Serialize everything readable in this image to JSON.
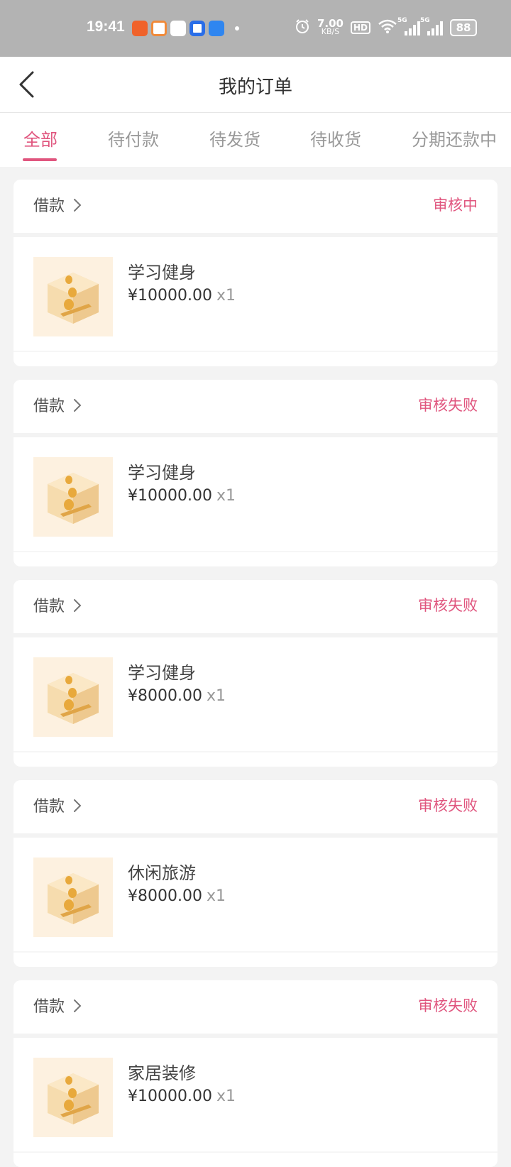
{
  "status_bar": {
    "time": "19:41",
    "net_speed": "7.00",
    "net_unit": "KB/S",
    "hd_label": "HD",
    "signal1_label": "5G",
    "signal2_label": "5G",
    "battery": "88"
  },
  "header": {
    "title": "我的订单"
  },
  "tabs": [
    {
      "label": "全部"
    },
    {
      "label": "待付款"
    },
    {
      "label": "待发货"
    },
    {
      "label": "待收货"
    },
    {
      "label": "分期还款中"
    }
  ],
  "orders": [
    {
      "type": "借款",
      "status": "审核中",
      "product": "学习健身",
      "price": "¥10000.00",
      "qty": "x1"
    },
    {
      "type": "借款",
      "status": "审核失败",
      "product": "学习健身",
      "price": "¥10000.00",
      "qty": "x1"
    },
    {
      "type": "借款",
      "status": "审核失败",
      "product": "学习健身",
      "price": "¥8000.00",
      "qty": "x1"
    },
    {
      "type": "借款",
      "status": "审核失败",
      "product": "休闲旅游",
      "price": "¥8000.00",
      "qty": "x1"
    },
    {
      "type": "借款",
      "status": "审核失败",
      "product": "家居装修",
      "price": "¥10000.00",
      "qty": "x1"
    }
  ],
  "colors": {
    "accent": "#e0557e",
    "background": "#f3f3f3",
    "statusbar": "#b3b3b3"
  }
}
